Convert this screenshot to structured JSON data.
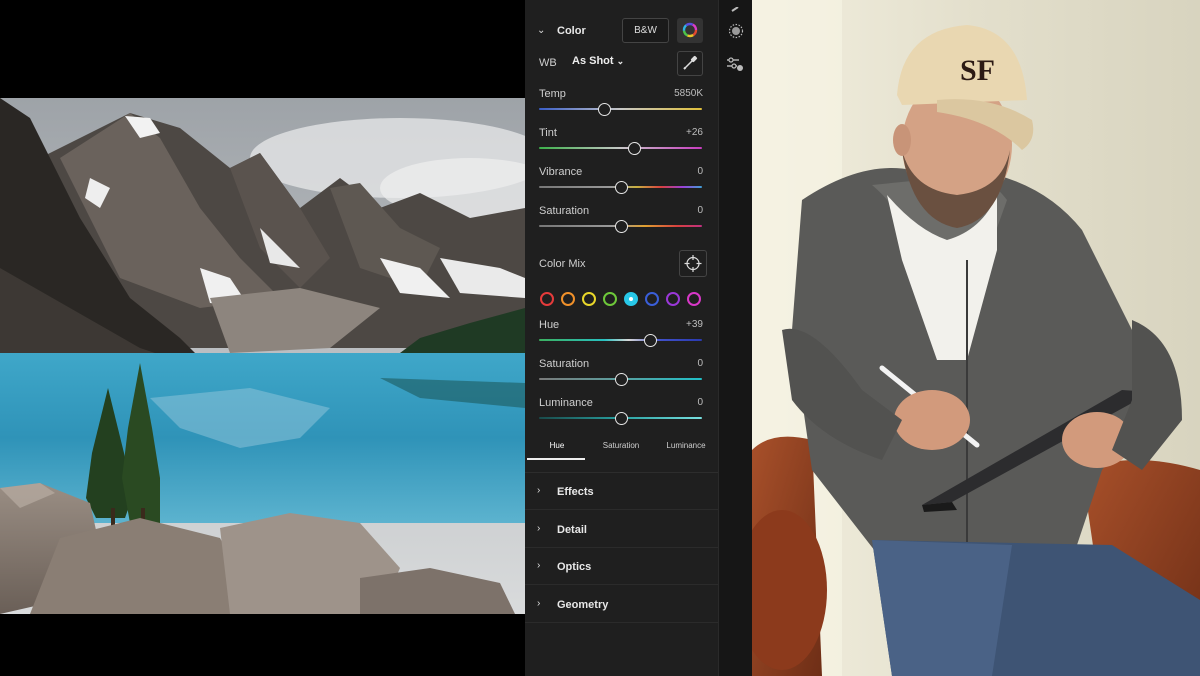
{
  "color_panel": {
    "title": "Color",
    "bw_label": "B&W",
    "wb_label": "WB",
    "wb_value": "As Shot",
    "sliders": [
      {
        "label": "Temp",
        "value": "5850K",
        "position": 0.4
      },
      {
        "label": "Tint",
        "value": "+26",
        "position": 0.58
      },
      {
        "label": "Vibrance",
        "value": "0",
        "position": 0.5
      },
      {
        "label": "Saturation",
        "value": "0",
        "position": 0.5
      }
    ]
  },
  "color_mix": {
    "title": "Color Mix",
    "swatches": [
      {
        "name": "red",
        "color": "#e53b3b"
      },
      {
        "name": "orange",
        "color": "#f0902a"
      },
      {
        "name": "yellow",
        "color": "#e9d62a"
      },
      {
        "name": "green",
        "color": "#6ec83a"
      },
      {
        "name": "aqua",
        "color": "#28c8e8",
        "active": true
      },
      {
        "name": "blue",
        "color": "#3a5ed8"
      },
      {
        "name": "purple",
        "color": "#9a38d8"
      },
      {
        "name": "magenta",
        "color": "#d838c8"
      }
    ],
    "sliders": [
      {
        "label": "Hue",
        "value": "+39",
        "position": 0.68
      },
      {
        "label": "Saturation",
        "value": "0",
        "position": 0.5
      },
      {
        "label": "Luminance",
        "value": "0",
        "position": 0.5
      }
    ],
    "tabs": [
      "Hue",
      "Saturation",
      "Luminance"
    ],
    "active_tab": "Hue"
  },
  "sections": [
    {
      "label": "Effects"
    },
    {
      "label": "Detail"
    },
    {
      "label": "Optics"
    },
    {
      "label": "Geometry"
    }
  ],
  "tool_icons": [
    "masking-icon",
    "presets-icon"
  ]
}
